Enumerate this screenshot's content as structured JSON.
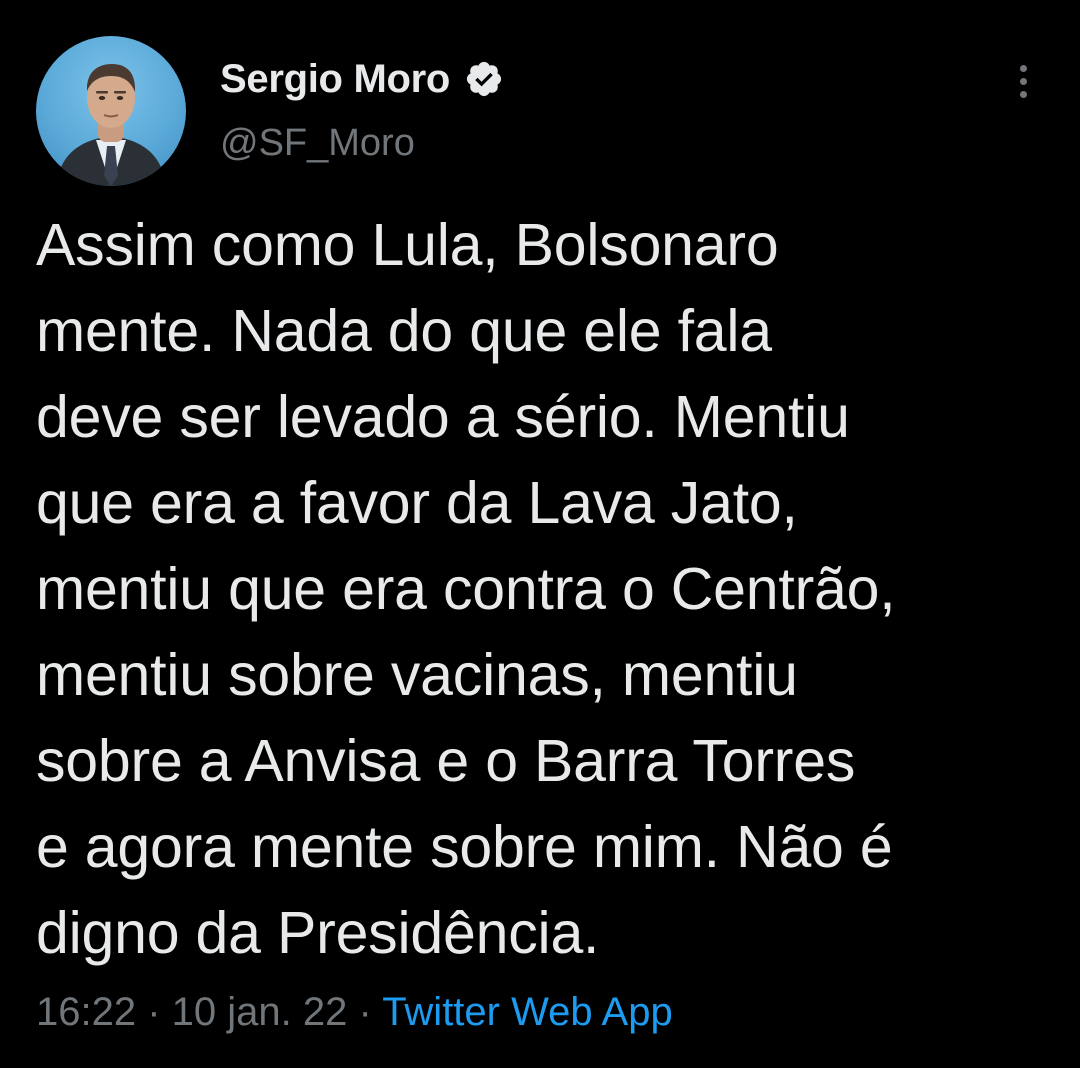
{
  "author": {
    "display_name": "Sergio Moro",
    "handle": "@SF_Moro",
    "verified_icon": "verified-badge-icon",
    "avatar_icon": "profile-photo"
  },
  "tweet": {
    "lines": [
      "Assim como Lula, Bolsonaro",
      "mente. Nada do que ele fala",
      "deve ser levado a sério. Mentiu",
      "que era a favor da Lava Jato,",
      "mentiu que era contra o Centrão,",
      "mentiu sobre vacinas, mentiu",
      "sobre a Anvisa e o Barra Torres",
      "e agora mente sobre mim. Não é",
      "digno da Presidência."
    ]
  },
  "meta": {
    "time": "16:22",
    "separator": " · ",
    "date": "10 jan. 22",
    "source": "Twitter Web App"
  },
  "menu": {
    "icon": "more-options-icon"
  },
  "colors": {
    "background": "#000000",
    "primary_text": "#e7e9ea",
    "secondary_text": "#71767b",
    "link": "#1d9bf0"
  }
}
